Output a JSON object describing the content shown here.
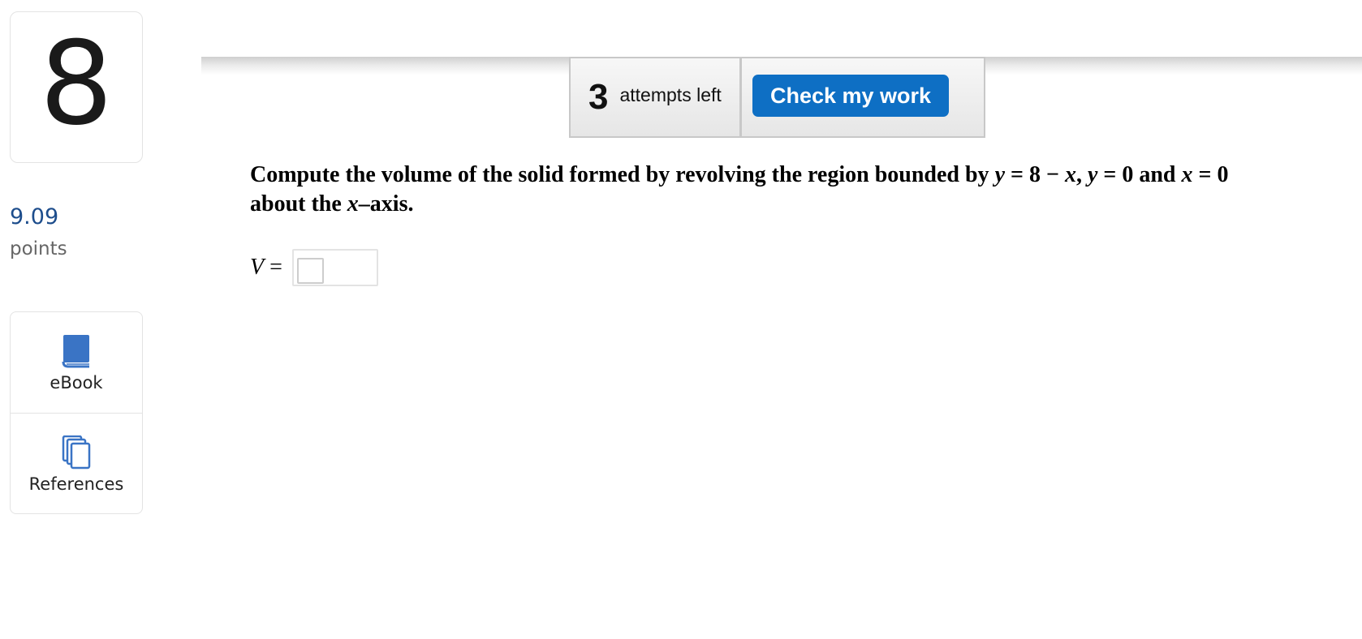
{
  "question": {
    "number": "8",
    "points_value": "9.09",
    "points_label": "points"
  },
  "resources": [
    {
      "label": "eBook",
      "icon": "book-icon"
    },
    {
      "label": "References",
      "icon": "documents-icon"
    }
  ],
  "submission": {
    "attempts_count": "3",
    "attempts_text": "attempts left",
    "check_button_label": "Check my work"
  },
  "problem": {
    "text_part1": "Compute the volume of the solid formed by revolving the region bounded by ",
    "math_y": "y",
    "eq": " = ",
    "eq1_rhs_num": "8",
    "minus": " − ",
    "math_x": "x",
    "comma": ", ",
    "zero": "0",
    "and": " and ",
    "text_part2": "about the ",
    "axis_suffix": "–axis.",
    "answer_label_var": "V",
    "answer_label_eq": " =",
    "answer_value": ""
  },
  "colors": {
    "accent_blue": "#0e6fc4",
    "points_blue": "#1d4d8c",
    "icon_blue": "#3a74c5"
  }
}
